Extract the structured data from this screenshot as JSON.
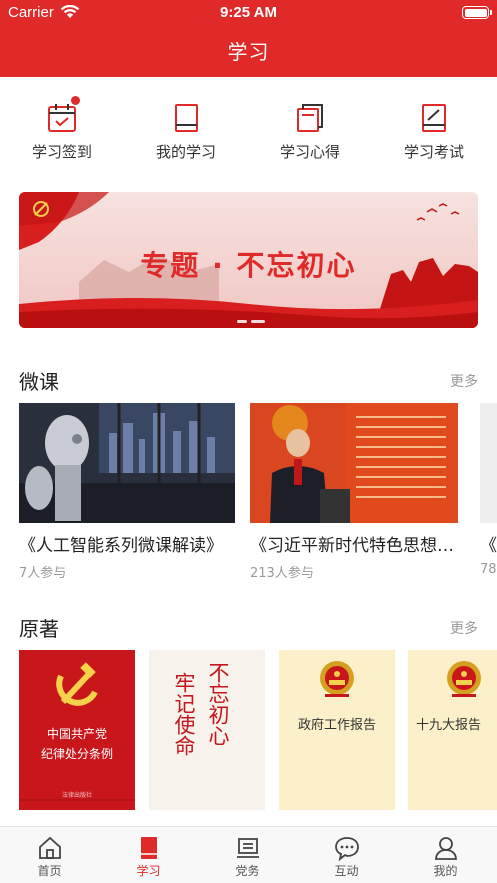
{
  "status_bar": {
    "carrier": "Carrier",
    "time": "9:25 AM"
  },
  "header": {
    "title": "学习"
  },
  "quick_actions": [
    {
      "label": "学习签到",
      "icon": "calendar-check-icon",
      "has_dot": true
    },
    {
      "label": "我的学习",
      "icon": "book-icon"
    },
    {
      "label": "学习心得",
      "icon": "notes-icon"
    },
    {
      "label": "学习考试",
      "icon": "exam-icon"
    }
  ],
  "banner": {
    "title": "专题 · 不忘初心",
    "active_slide": 2,
    "slide_count": 2
  },
  "micro_course": {
    "title": "微课",
    "more": "更多",
    "items": [
      {
        "title": "《人工智能系列微课解读》",
        "participants": "7人参与"
      },
      {
        "title": "《习近平新时代特色思想解读》",
        "participants": "213人参与"
      },
      {
        "title": "《",
        "participants": "78"
      }
    ]
  },
  "originals": {
    "title": "原著",
    "more": "更多",
    "books": [
      {
        "cover_line1": "中国共产党",
        "cover_line2": "纪律处分条例",
        "publisher": "法律出版社"
      },
      {
        "cover_col1": "不忘初心",
        "cover_col2": "牢记使命"
      },
      {
        "cover_title": "政府工作报告"
      },
      {
        "cover_title": "十九大报告"
      }
    ]
  },
  "tab_bar": {
    "active": "学习",
    "tabs": [
      {
        "label": "首页",
        "icon": "home-icon"
      },
      {
        "label": "学习",
        "icon": "book-icon"
      },
      {
        "label": "党务",
        "icon": "building-icon"
      },
      {
        "label": "互动",
        "icon": "chat-bubble-icon"
      },
      {
        "label": "我的",
        "icon": "person-icon"
      }
    ]
  },
  "colors": {
    "accent": "#e02a2a",
    "banner_bg": "#f3d3d0",
    "book_cream": "#fbf0c9"
  }
}
